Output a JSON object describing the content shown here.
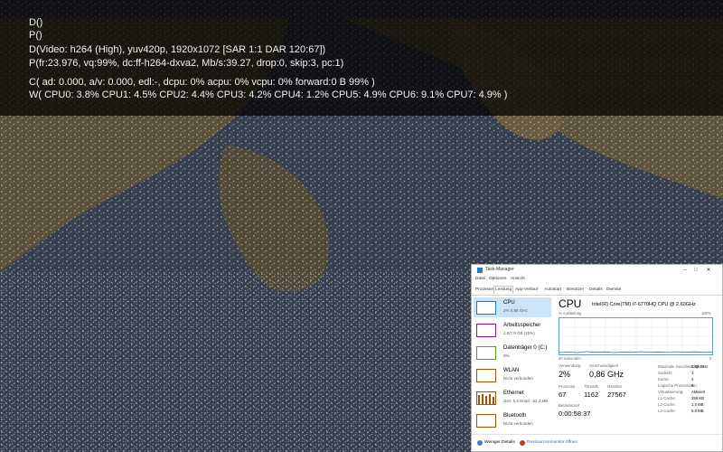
{
  "osd": {
    "lines": [
      "D()",
      "P()",
      "D(Video: h264 (High), yuv420p, 1920x1072 [SAR 1:1 DAR 120:67])",
      "P(fr:23.976, vq:99%, dc:ff-h264-dxva2, Mb/s:39.27, drop:0, skip:3, pc:1)",
      "C( ad: 0.000, a/v: 0.000, edl:-, dcpu: 0% acpu: 0% vcpu: 0% forward:0 B 99% )",
      "W( CPU0: 3.8% CPU1: 4.5% CPU2: 4.4% CPU3: 4.2% CPU4: 1.2% CPU5: 4.9% CPU6: 9.1% CPU7: 4.9% )"
    ]
  },
  "taskmanager": {
    "title": "Task-Manager",
    "menu": [
      "Datei",
      "Optionen",
      "Ansicht"
    ],
    "tabs": [
      "Prozesse",
      "Leistung",
      "App-Verlauf",
      "Autostart",
      "Benutzer",
      "Details",
      "Dienste"
    ],
    "active_tab": "Leistung",
    "sidebar": [
      {
        "name": "CPU",
        "sub": "2%  0,86 GHz",
        "color": "#117dbb"
      },
      {
        "name": "Arbeitsspeicher",
        "sub": "2,0/7,9 GB (25%)",
        "color": "#8b12ae"
      },
      {
        "name": "Datenträger 0 (C:)",
        "sub": "0%",
        "color": "#4da60c"
      },
      {
        "name": "WLAN",
        "sub": "Nicht verbunden",
        "color": "#a74f01"
      },
      {
        "name": "Ethernet",
        "sub": "Ges: 0,5  Empf.: 62,3 MB",
        "color": "#a74f01"
      },
      {
        "name": "Bluetooth",
        "sub": "Nicht verbunden",
        "color": "#a74f01"
      }
    ],
    "detail": {
      "title": "CPU",
      "model": "Intel(R) Core(TM) i7-6770HQ CPU @ 2.60GHz",
      "graph_label": "% Auslastung",
      "graph_max": "100%",
      "graph_time": "60 Sekunden",
      "graph_min": "0",
      "stats": {
        "usage_label": "Verwendung",
        "usage": "2%",
        "speed_label": "Geschwindigkeit",
        "speed": "0,86 GHz",
        "processes_label": "Prozesse",
        "processes": "67",
        "threads_label": "Threads",
        "threads": "1162",
        "handles_label": "Handles",
        "handles": "27567",
        "uptime_label": "Betriebszeit",
        "uptime": "0:00:58:37"
      },
      "right": [
        {
          "label": "Maximale Geschwindigkeit:",
          "value": "2,59 GHz"
        },
        {
          "label": "Sockets:",
          "value": "1"
        },
        {
          "label": "Kerne:",
          "value": "4"
        },
        {
          "label": "Logische Prozessoren:",
          "value": "8"
        },
        {
          "label": "Virtualisierung:",
          "value": "Aktiviert"
        },
        {
          "label": "L1-Cache:",
          "value": "256 KB"
        },
        {
          "label": "L2-Cache:",
          "value": "1,0 MB"
        },
        {
          "label": "L3-Cache:",
          "value": "6,0 MB"
        }
      ]
    },
    "footer": {
      "fewer": "Weniger Details",
      "resmon": "Ressourcenmonitor öffnen"
    },
    "colors": {
      "accent": "#117dbb",
      "link": "#1a6fc4"
    }
  }
}
